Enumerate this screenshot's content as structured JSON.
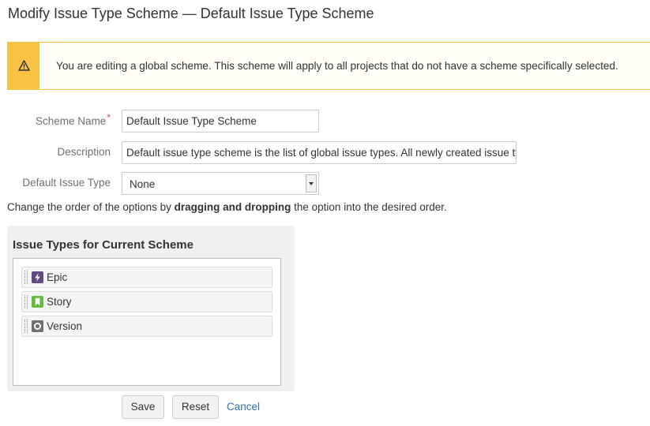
{
  "page": {
    "title": "Modify Issue Type Scheme — Default Issue Type Scheme"
  },
  "warning": {
    "message": "You are editing a global scheme. This scheme will apply to all projects that do not have a scheme specifically selected.",
    "icon": "warning-icon",
    "color": "#f6c342"
  },
  "form": {
    "scheme_name": {
      "label": "Scheme Name",
      "required_marker": "*",
      "value": "Default Issue Type Scheme"
    },
    "description": {
      "label": "Description",
      "value": "Default issue type scheme is the list of global issue types. All newly created issue types will automatically be added to this scheme."
    },
    "default_issue_type": {
      "label": "Default Issue Type",
      "selected": "None"
    }
  },
  "hint": {
    "before": "Change the order of the options by ",
    "bold": "dragging and dropping",
    "after": " the option into the desired order."
  },
  "issue_types_panel": {
    "title": "Issue Types for Current Scheme",
    "items": [
      {
        "label": "Epic",
        "icon": "epic-icon",
        "color": "#654982"
      },
      {
        "label": "Story",
        "icon": "story-icon",
        "color": "#63ba3c"
      },
      {
        "label": "Version",
        "icon": "version-icon",
        "color": "#707070"
      }
    ]
  },
  "actions": {
    "save": "Save",
    "reset": "Reset",
    "cancel": "Cancel"
  }
}
